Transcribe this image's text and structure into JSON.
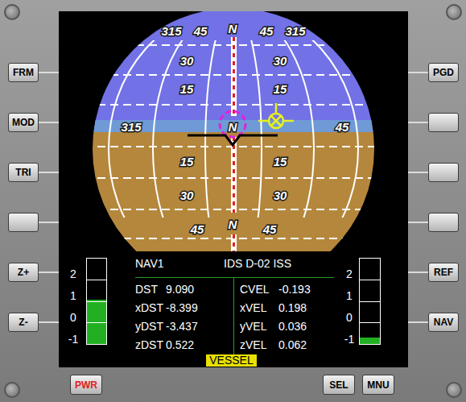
{
  "frame": {
    "left_buttons": [
      {
        "label": "FRM"
      },
      {
        "label": "MOD"
      },
      {
        "label": "TRI"
      },
      {
        "label": ""
      },
      {
        "label": "Z+"
      },
      {
        "label": "Z-"
      }
    ],
    "right_buttons": [
      {
        "label": "PGD"
      },
      {
        "label": ""
      },
      {
        "label": ""
      },
      {
        "label": ""
      },
      {
        "label": "REF"
      },
      {
        "label": "NAV"
      }
    ],
    "bottom_buttons": [
      {
        "label": "PWR",
        "color": "#e02020"
      },
      {
        "label": "SEL",
        "color": "#000000"
      },
      {
        "label": "MNU",
        "color": "#000000"
      }
    ]
  },
  "ball": {
    "labels": [
      {
        "text": "315"
      },
      {
        "text": "45"
      },
      {
        "text": "N"
      },
      {
        "text": "45"
      },
      {
        "text": "315"
      },
      {
        "text": "315"
      },
      {
        "text": "N"
      },
      {
        "text": "45"
      },
      {
        "text": "30"
      },
      {
        "text": "30"
      },
      {
        "text": "15"
      },
      {
        "text": "15"
      },
      {
        "text": "15"
      },
      {
        "text": "15"
      },
      {
        "text": "30"
      },
      {
        "text": "30"
      },
      {
        "text": "45"
      },
      {
        "text": "N"
      },
      {
        "text": "45"
      }
    ]
  },
  "nav": {
    "source": "NAV1",
    "target": "IDS D-02 ISS",
    "mode": "VESSEL"
  },
  "readouts": {
    "left": [
      {
        "label": "DST",
        "value": "9.090"
      },
      {
        "label": "xDST",
        "value": "-8.399"
      },
      {
        "label": "yDST",
        "value": "-3.437"
      },
      {
        "label": "zDST",
        "value": "0.522"
      }
    ],
    "right": [
      {
        "label": "CVEL",
        "value": "-0.193"
      },
      {
        "label": "xVEL",
        "value": "0.198"
      },
      {
        "label": "yVEL",
        "value": "0.036"
      },
      {
        "label": "zVEL",
        "value": "0.062"
      }
    ]
  },
  "gauges": [
    {
      "ticks": [
        "2",
        "1",
        "0",
        "-1"
      ],
      "level": 0.52
    },
    {
      "ticks": [
        "2",
        "1",
        "0",
        "-1"
      ],
      "level": 0.08
    }
  ]
}
